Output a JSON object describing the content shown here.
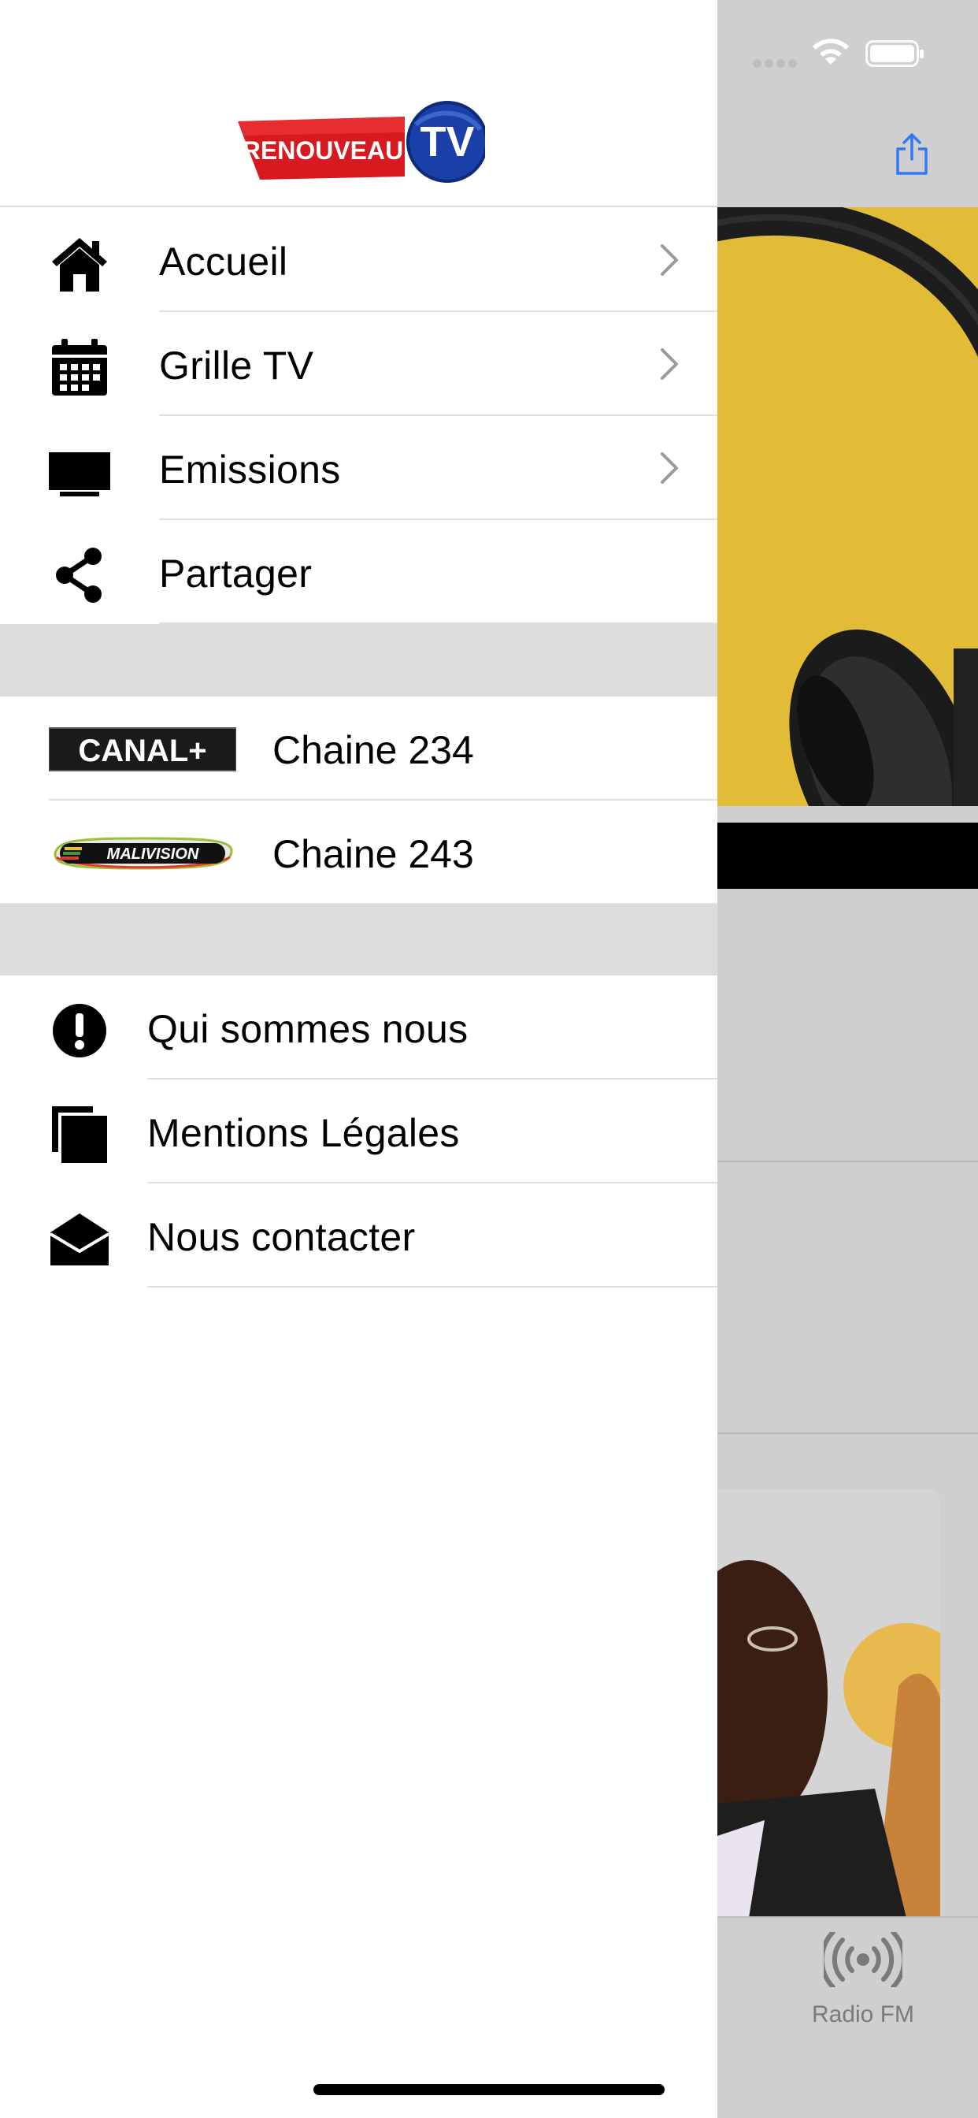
{
  "header": {
    "logo_text_left": "RENOUVEAU",
    "logo_text_right": "TV"
  },
  "menu": {
    "items": [
      {
        "label": "Accueil",
        "icon": "home-icon",
        "has_chevron": true
      },
      {
        "label": "Grille TV",
        "icon": "calendar-icon",
        "has_chevron": true
      },
      {
        "label": "Emissions",
        "icon": "tv-icon",
        "has_chevron": true
      },
      {
        "label": "Partager",
        "icon": "share-icon",
        "has_chevron": false
      }
    ]
  },
  "channels": {
    "items": [
      {
        "label": "Chaine 234",
        "logo_text": "CANAL+"
      },
      {
        "label": "Chaine 243",
        "logo_text": "MALIVISION"
      }
    ]
  },
  "info": {
    "items": [
      {
        "label": "Qui sommes nous",
        "icon": "exclamation-circle-icon"
      },
      {
        "label": "Mentions Légales",
        "icon": "copy-icon"
      },
      {
        "label": "Nous contacter",
        "icon": "envelope-open-icon"
      }
    ]
  },
  "tabbar": {
    "radio_label": "Radio FM",
    "radio_icon": "broadcast-icon"
  },
  "colors": {
    "accent": "#3478f6",
    "overlay": "#cfcfcf",
    "logo_red": "#d71920",
    "logo_blue": "#1a3fa8"
  }
}
